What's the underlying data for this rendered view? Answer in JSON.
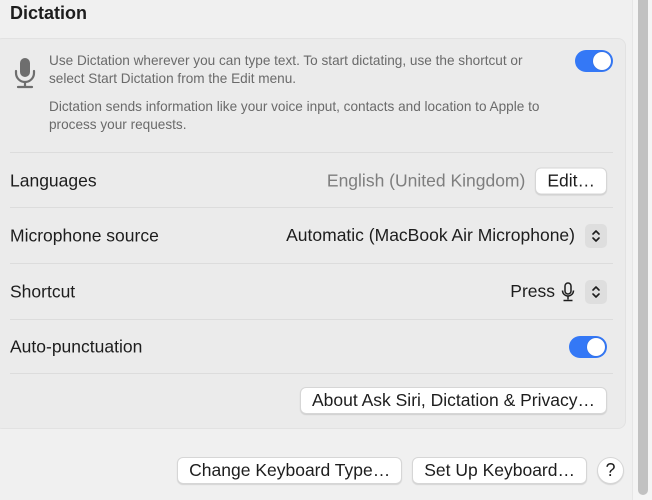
{
  "section": {
    "title": "Dictation"
  },
  "intro": {
    "icon": "microphone-icon",
    "description": "Use Dictation wherever you can type text. To start dictating, use the shortcut or select Start Dictation from the Edit menu.",
    "privacy_note": "Dictation sends information like your voice input, contacts and location to Apple to process your requests.",
    "dictation_enabled": true
  },
  "rows": {
    "languages": {
      "label": "Languages",
      "value": "English (United Kingdom)",
      "button": "Edit…"
    },
    "microphone_source": {
      "label": "Microphone source",
      "value": "Automatic (MacBook Air Microphone)",
      "control_icon": "up-down-chevron-icon"
    },
    "shortcut": {
      "label": "Shortcut",
      "value": "Press",
      "key_icon": "microphone-key-icon",
      "control_icon": "up-down-chevron-icon"
    },
    "auto_punctuation": {
      "label": "Auto-punctuation",
      "enabled": true
    },
    "about": {
      "button": "About Ask Siri, Dictation & Privacy…"
    }
  },
  "footer": {
    "change_keyboard_type": "Change Keyboard Type…",
    "set_up_keyboard": "Set Up Keyboard…",
    "help": "?"
  },
  "colors": {
    "accent": "#3478f6",
    "background": "#f0f0f0",
    "panel": "#ebebeb"
  }
}
